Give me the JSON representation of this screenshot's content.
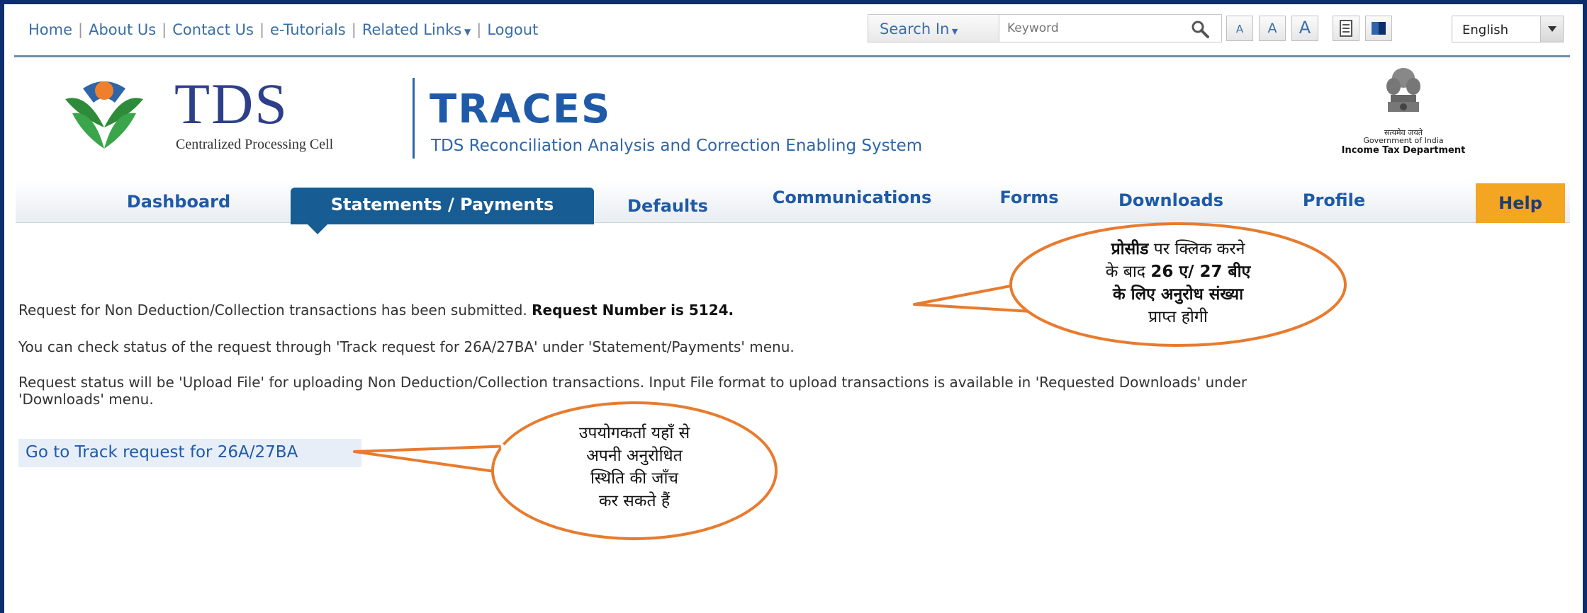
{
  "toplinks": {
    "home": "Home",
    "about": "About Us",
    "contact": "Contact Us",
    "tutorials": "e-Tutorials",
    "related": "Related Links",
    "logout": "Logout"
  },
  "search": {
    "search_in_label": "Search In",
    "placeholder": "Keyword"
  },
  "font_controls": [
    "A",
    "A",
    "A"
  ],
  "language": {
    "selected": "English"
  },
  "logo": {
    "tds": "TDS",
    "tds_sub": "Centralized Processing Cell",
    "traces": "TRACES",
    "traces_sub": "TDS Reconciliation Analysis and Correction Enabling System"
  },
  "gov": {
    "hindi": "सत्यमेव जयते",
    "line1": "Government of India",
    "line2": "Income Tax Department"
  },
  "nav": {
    "dashboard": "Dashboard",
    "statements": "Statements / Payments",
    "defaults": "Defaults",
    "communications": "Communications",
    "forms": "Forms",
    "downloads": "Downloads",
    "profile": "Profile",
    "help": "Help"
  },
  "content": {
    "msg1_prefix": "Request for Non Deduction/Collection transactions has been submitted.",
    "msg1_bold": "Request Number is 5124.",
    "msg2": "You can check status of the request through 'Track request for 26A/27BA' under 'Statement/Payments' menu.",
    "msg3_line1": "Request status will be 'Upload File' for uploading Non Deduction/Collection transactions. Input File format to upload transactions is available in 'Requested Downloads' under",
    "msg3_line2": "'Downloads' menu.",
    "track_link": "Go to Track request for 26A/27BA"
  },
  "callouts": {
    "top": {
      "line1_bold": "प्रोसीड",
      "line1_rest": " पर क्लिक करने",
      "line2_prefix": "के बाद ",
      "line2_bold": "26 ए/ 27 बीए",
      "line3": "के लिए अनुरोध संख्या",
      "line4": "प्राप्त होगी"
    },
    "bottom": {
      "line1": "उपयोगकर्ता यहाँ से",
      "line2": "अपनी अनुरोधित",
      "line3": "स्थिति की जाँच",
      "line4": "कर सकते हैं"
    }
  },
  "colors": {
    "brand_blue": "#1f5aa8",
    "active_tab": "#175c93",
    "help_tab": "#f4a521",
    "callout_border": "#e87b2e",
    "frame": "#0d2d6e"
  }
}
